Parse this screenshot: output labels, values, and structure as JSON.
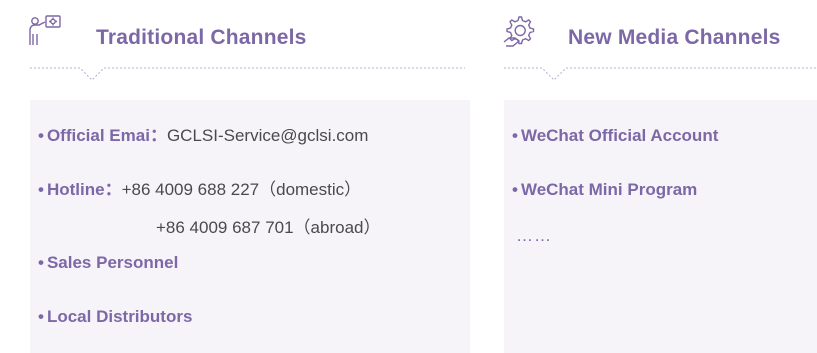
{
  "sections": {
    "traditional": {
      "title": "Traditional Channels",
      "icon": "person-presenting-icon",
      "items": {
        "email": {
          "label": "Official Emai",
          "separator": "：",
          "value": "GCLSI-Service@gclsi.com"
        },
        "hotline": {
          "label": "Hotline",
          "separator": "：",
          "line1": "+86 4009 688 227（domestic）",
          "line2": "+86 4009 687 701（abroad）"
        },
        "sales": {
          "label": "Sales Personnel"
        },
        "distributors": {
          "label": "Local Distributors"
        }
      }
    },
    "new_media": {
      "title": "New Media Channels",
      "icon": "gear-hand-icon",
      "items": {
        "wechat_official": {
          "label": "WeChat Official Account"
        },
        "wechat_mini": {
          "label": "WeChat Mini Program"
        },
        "more": "……"
      }
    }
  },
  "colors": {
    "accent": "#7c68a6",
    "text": "#4a4a4a",
    "panel_bg": "#f6f4f9",
    "divider": "#b8aed0"
  }
}
